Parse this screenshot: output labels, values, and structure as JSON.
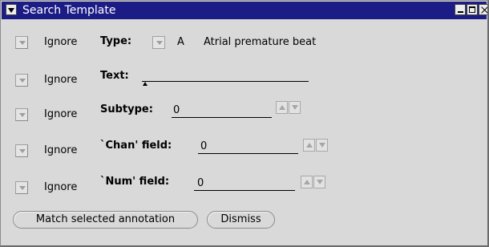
{
  "window": {
    "title": "Search Template"
  },
  "rows": {
    "type": {
      "ignore_label": "Ignore",
      "field_label": "Type:",
      "code": "A",
      "description": "Atrial premature beat"
    },
    "text": {
      "ignore_label": "Ignore",
      "field_label": "Text:",
      "value": ""
    },
    "subtype": {
      "ignore_label": "Ignore",
      "field_label": "Subtype:",
      "value": "0"
    },
    "chan": {
      "ignore_label": "Ignore",
      "field_label": "`Chan' field:",
      "value": "0"
    },
    "num": {
      "ignore_label": "Ignore",
      "field_label": "`Num' field:",
      "value": "0"
    }
  },
  "buttons": {
    "match": "Match selected annotation",
    "dismiss": "Dismiss"
  },
  "colors": {
    "titlebar": "#1c1c86",
    "window_bg": "#d9d9d9"
  }
}
